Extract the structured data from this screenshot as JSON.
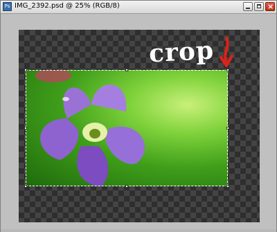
{
  "window": {
    "title": "IMG_2392.psd @ 25% (RGB/8)",
    "app_icon": "Ps"
  },
  "controls": {
    "minimize_icon": "minimize-icon",
    "maximize_icon": "maximize-icon",
    "close_icon": "close-icon",
    "close_glyph": "×"
  },
  "canvas": {
    "annotation_text": "crop",
    "annotation_color": "#ffffff",
    "arrow_color": "#e0201a"
  }
}
